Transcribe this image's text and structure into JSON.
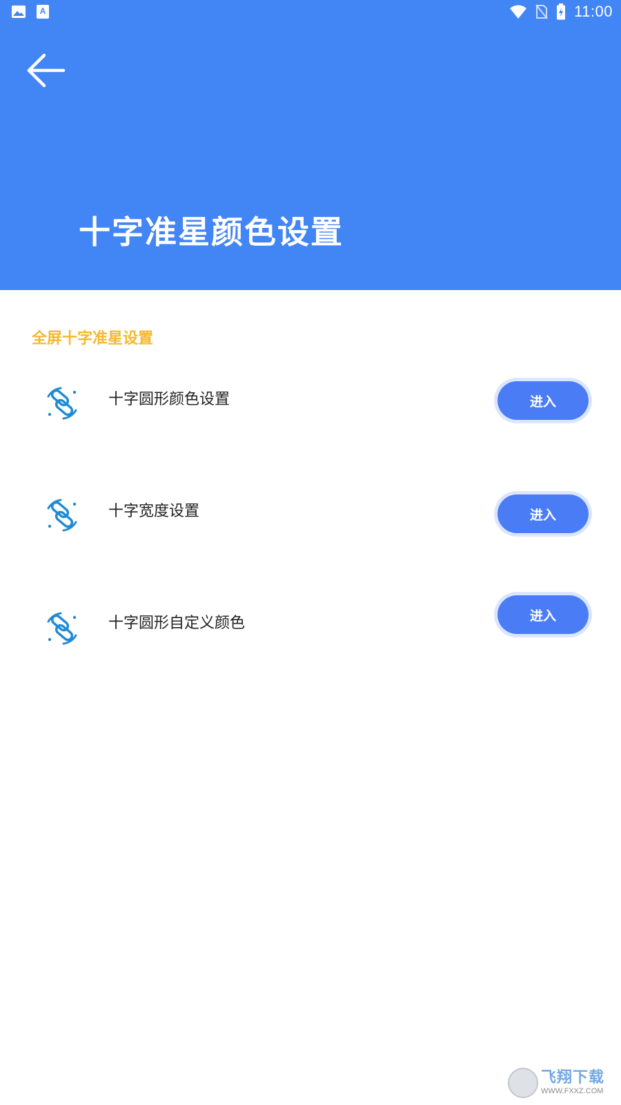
{
  "status_bar": {
    "time": "11:00",
    "left_icons": [
      "image-icon",
      "font-icon"
    ],
    "right_icons": [
      "wifi-icon",
      "no-sim-icon",
      "battery-charging-icon"
    ]
  },
  "header": {
    "title": "十字准星颜色设置",
    "background_color": "#4285f4"
  },
  "section": {
    "title": "全屏十字准星设置",
    "title_color": "#f5b82e"
  },
  "items": [
    {
      "label": "十字圆形颜色设置",
      "button": "进入",
      "icon": "crosshair-link-icon"
    },
    {
      "label": "十字宽度设置",
      "button": "进入",
      "icon": "crosshair-link-icon"
    },
    {
      "label": "十字圆形自定义颜色",
      "button": "进入",
      "icon": "crosshair-link-icon"
    }
  ],
  "accent_color": "#4a7df5",
  "watermark": {
    "cn": "飞翔下载",
    "en": "WWW.FXXZ.COM"
  }
}
